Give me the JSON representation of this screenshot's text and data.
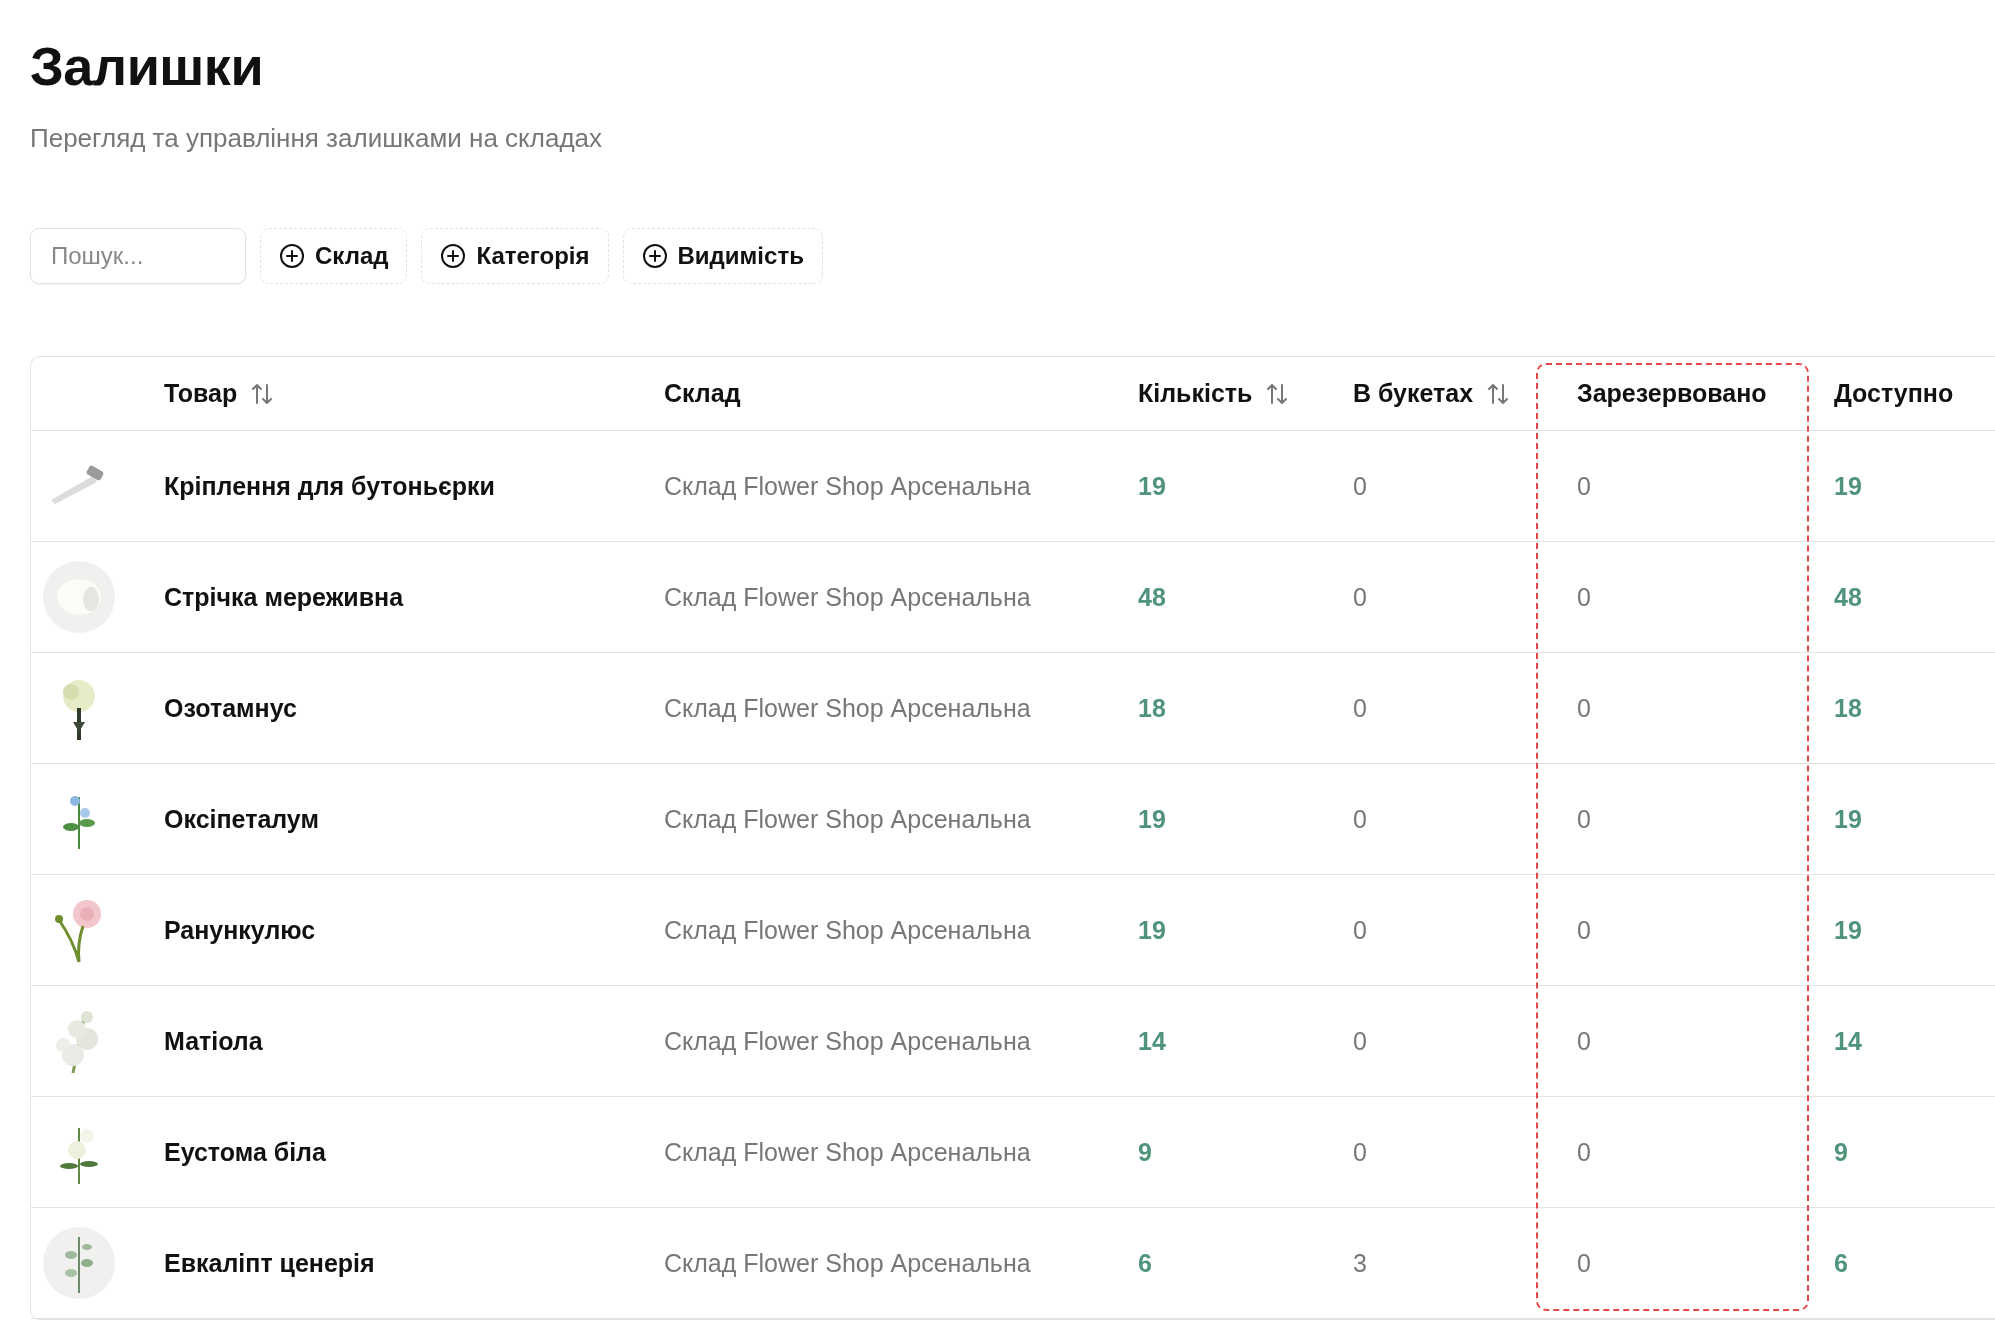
{
  "page": {
    "title": "Залишки",
    "subtitle": "Перегляд та управління залишками на складах"
  },
  "toolbar": {
    "search": {
      "placeholder": "Пошук..."
    },
    "filters": [
      "Склад",
      "Категорія",
      "Видимість"
    ]
  },
  "table": {
    "columns": [
      {
        "label": "Товар",
        "sortable": true,
        "highlighted": false
      },
      {
        "label": "Склад",
        "sortable": false,
        "highlighted": false
      },
      {
        "label": "Кількість",
        "sortable": true,
        "highlighted": false
      },
      {
        "label": "В букетах",
        "sortable": true,
        "highlighted": false
      },
      {
        "label": "Зарезервовано",
        "sortable": false,
        "highlighted": true
      },
      {
        "label": "Доступно",
        "sortable": false,
        "highlighted": false
      }
    ],
    "rows": [
      {
        "product": "Кріплення для бутоньєрки",
        "warehouse": "Склад Flower Shop Арсенальна",
        "quantity": "19",
        "in_bouquets": "0",
        "reserved": "0",
        "available": "19"
      },
      {
        "product": "Стрічка мереживна",
        "warehouse": "Склад Flower Shop Арсенальна",
        "quantity": "48",
        "in_bouquets": "0",
        "reserved": "0",
        "available": "48"
      },
      {
        "product": "Озотамнус",
        "warehouse": "Склад Flower Shop Арсенальна",
        "quantity": "18",
        "in_bouquets": "0",
        "reserved": "0",
        "available": "18"
      },
      {
        "product": "Оксіпеталум",
        "warehouse": "Склад Flower Shop Арсенальна",
        "quantity": "19",
        "in_bouquets": "0",
        "reserved": "0",
        "available": "19"
      },
      {
        "product": "Ранункулюс",
        "warehouse": "Склад Flower Shop Арсенальна",
        "quantity": "19",
        "in_bouquets": "0",
        "reserved": "0",
        "available": "19"
      },
      {
        "product": "Матіола",
        "warehouse": "Склад Flower Shop Арсенальна",
        "quantity": "14",
        "in_bouquets": "0",
        "reserved": "0",
        "available": "14"
      },
      {
        "product": "Еустома біла",
        "warehouse": "Склад Flower Shop Арсенальна",
        "quantity": "9",
        "in_bouquets": "0",
        "reserved": "0",
        "available": "9"
      },
      {
        "product": "Евкаліпт ценерія",
        "warehouse": "Склад Flower Shop Арсенальна",
        "quantity": "6",
        "in_bouquets": "3",
        "reserved": "0",
        "available": "6"
      }
    ]
  }
}
